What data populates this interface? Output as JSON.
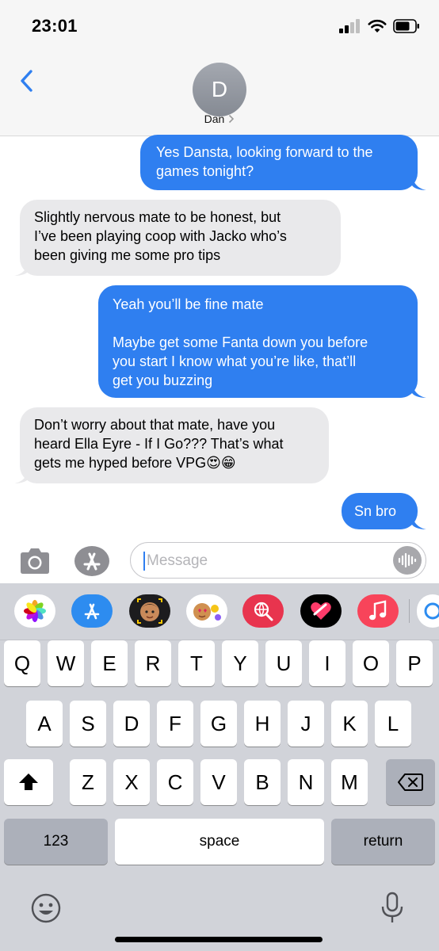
{
  "status_bar": {
    "time": "23:01"
  },
  "header": {
    "avatar_initial": "D",
    "contact_name": "Dan"
  },
  "messages": [
    {
      "from": "me",
      "text": "Yes Dansta, looking forward to the\ngames tonight?"
    },
    {
      "from": "them",
      "text": "Slightly nervous mate to be honest, but\nI’ve been playing coop with Jacko who’s\nbeen giving me some pro tips"
    },
    {
      "from": "me",
      "text": "Yeah you’ll be fine mate\n\nMaybe get some Fanta down you before\nyou start I know what you’re like, that’ll\nget you buzzing"
    },
    {
      "from": "them",
      "text": "Don’t worry about that mate, have you\nheard Ella Eyre - If I Go??? That’s what\ngets me hyped before VPG😍😁"
    },
    {
      "from": "me",
      "text": "Sn bro"
    }
  ],
  "input": {
    "placeholder": "Message"
  },
  "app_strip": [
    "photos-icon",
    "app-store-icon",
    "memoji-icon",
    "memoji-stickers-icon",
    "web-images-icon",
    "digital-touch-icon",
    "music-icon",
    "more-apps-icon"
  ],
  "keyboard": {
    "row1": [
      "Q",
      "W",
      "E",
      "R",
      "T",
      "Y",
      "U",
      "I",
      "O",
      "P"
    ],
    "row2": [
      "A",
      "S",
      "D",
      "F",
      "G",
      "H",
      "J",
      "K",
      "L"
    ],
    "row3": [
      "Z",
      "X",
      "C",
      "V",
      "B",
      "N",
      "M"
    ],
    "numbers_label": "123",
    "space_label": "space",
    "return_label": "return"
  },
  "colors": {
    "sent_bubble": "#2f7ff0",
    "received_bubble": "#e9e9eb",
    "keyboard_bg": "#d1d3d9"
  }
}
